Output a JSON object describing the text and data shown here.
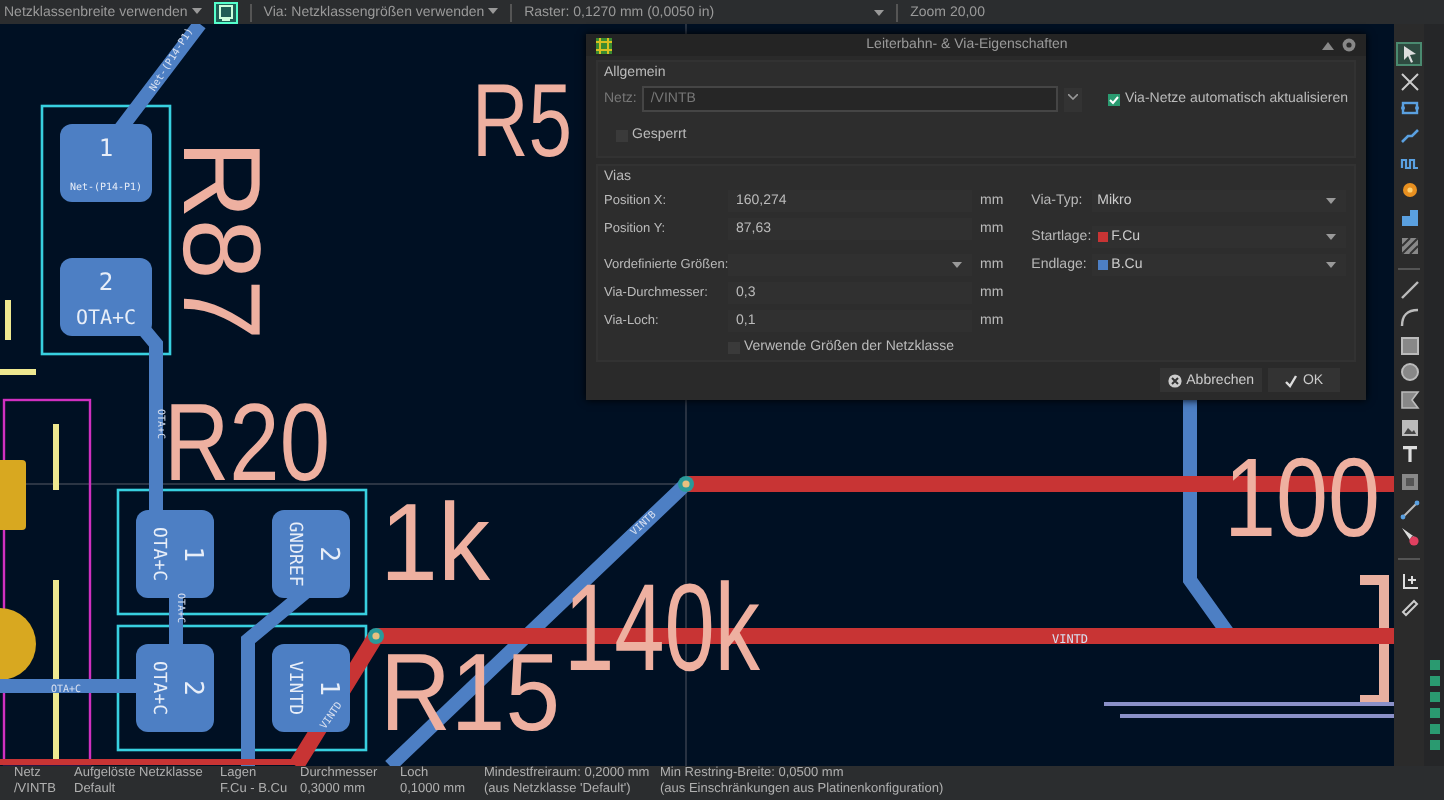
{
  "toolbar": {
    "track_width": "Netzklassenbreite verwenden",
    "highlight_button_on": true,
    "via_size": "Via: Netzklassengrößen verwenden",
    "grid": "Raster: 0,1270 mm (0,0050 in)",
    "zoom": "Zoom 20,00"
  },
  "canvas": {
    "silkscreen": [
      "R5",
      "R87",
      "R20",
      "1k",
      "R15",
      "140k",
      "100"
    ],
    "pads": [
      {
        "number": "1",
        "net": "Net-(P14-P1)"
      },
      {
        "number": "2",
        "net": "OTA+C"
      },
      {
        "number": "1",
        "net": "OTA+C"
      },
      {
        "number": "2",
        "net": "GNDREF"
      },
      {
        "number": "2",
        "net": "OTA+C"
      },
      {
        "number": "1",
        "net": "VINTD"
      }
    ],
    "track_labels": [
      "Net-(P14-P1)",
      "OTA+C",
      "OTA+C",
      "OTA+C",
      "VINTB",
      "VINTD",
      "VINTD"
    ]
  },
  "dialog": {
    "title": "Leiterbahn- & Via-Eigenschaften",
    "general": {
      "heading": "Allgemein",
      "net_label": "Netz:",
      "net_value": "/VINTB",
      "auto_update": {
        "label": "Via-Netze automatisch aktualisieren",
        "checked": true
      },
      "locked": {
        "label": "Gesperrt",
        "checked": false
      }
    },
    "vias": {
      "heading": "Vias",
      "fields": [
        {
          "kind": "input",
          "label": "Position X:",
          "value": "160,274",
          "unit": "mm"
        },
        {
          "kind": "input",
          "label": "Position Y:",
          "value": "87,63",
          "unit": "mm"
        },
        {
          "kind": "dropdown",
          "label": "Vordefinierte Größen:",
          "unit": "mm"
        },
        {
          "kind": "input",
          "label": "Via-Durchmesser:",
          "value": "0,3",
          "unit": "mm"
        },
        {
          "kind": "input",
          "label": "Via-Loch:",
          "value": "0,1",
          "unit": "mm"
        }
      ],
      "selects": [
        {
          "label": "Via-Typ:",
          "value": "Mikro"
        },
        {
          "label": "Startlage:",
          "value": "F.Cu",
          "color": "#c83434"
        },
        {
          "label": "Endlage:",
          "value": "B.Cu",
          "color": "#4d7fc4"
        }
      ],
      "use_netclass": {
        "label": "Verwende Größen der Netzklasse",
        "checked": false
      }
    },
    "buttons": [
      {
        "kind": "cancel",
        "label": "Abbrechen"
      },
      {
        "kind": "ok",
        "label": "OK"
      }
    ]
  },
  "right_toolbar": [
    {
      "kind": "select",
      "selected": true
    },
    {
      "kind": "cross",
      "selected": false
    },
    {
      "kind": "footprint",
      "selected": false
    },
    {
      "kind": "route",
      "selected": false
    },
    {
      "kind": "tune",
      "selected": false
    },
    {
      "kind": "via",
      "selected": false
    },
    {
      "kind": "zone",
      "selected": false
    },
    {
      "kind": "hatch",
      "selected": false
    },
    {
      "kind": "separator"
    },
    {
      "kind": "line",
      "selected": false
    },
    {
      "kind": "arc",
      "selected": false
    },
    {
      "kind": "rect",
      "selected": false
    },
    {
      "kind": "circle",
      "selected": false
    },
    {
      "kind": "polygon",
      "selected": false
    },
    {
      "kind": "image",
      "selected": false
    },
    {
      "kind": "text",
      "selected": false
    },
    {
      "kind": "textbox",
      "selected": false
    },
    {
      "kind": "dimension",
      "selected": false
    },
    {
      "kind": "delete",
      "selected": false
    },
    {
      "kind": "separator"
    },
    {
      "kind": "origin",
      "selected": false
    },
    {
      "kind": "measure",
      "selected": false
    }
  ],
  "side_panel": {
    "layer_visibility": [
      {
        "checked": true
      },
      {
        "checked": true
      },
      {
        "checked": true
      },
      {
        "checked": true
      },
      {
        "checked": true
      },
      {
        "checked": true
      }
    ]
  },
  "status_bar": [
    {
      "heading": "Netz",
      "value": "/VINTB"
    },
    {
      "heading": "Aufgelöste Netzklasse",
      "value": "Default"
    },
    {
      "heading": "Lagen",
      "value": "F.Cu - B.Cu"
    },
    {
      "heading": "Durchmesser",
      "value": "0,3000 mm"
    },
    {
      "heading": "Loch",
      "value": "0,1000 mm"
    },
    {
      "heading": "Mindestfreiraum: 0,2000 mm",
      "value": "(aus Netzklasse 'Default')"
    },
    {
      "heading": "Min Restring-Breite: 0,0500 mm",
      "value": "(aus Einschränkungen aus Platinenkonfiguration)"
    }
  ]
}
